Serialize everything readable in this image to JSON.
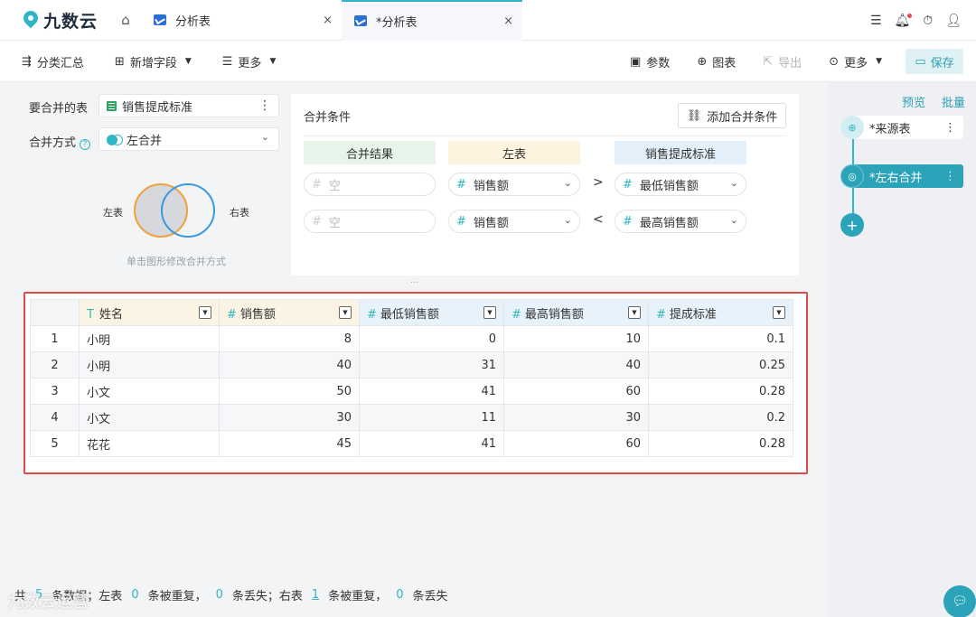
{
  "app": {
    "logo_text": "九数云"
  },
  "tabs": [
    {
      "label": "分析表",
      "close": "×"
    },
    {
      "label": "*分析表",
      "close": "×"
    }
  ],
  "top_icons": [
    "list-icon",
    "bell-icon",
    "timer-icon",
    "user-icon"
  ],
  "toolbar": {
    "group_summary": "分类汇总",
    "add_field": "新增字段",
    "more_left": "更多",
    "params": "参数",
    "chart": "图表",
    "export": "导出",
    "more_right": "更多",
    "save": "保存"
  },
  "config": {
    "table_label": "要合并的表",
    "table_value": "销售提成标准",
    "method_label": "合并方式",
    "method_value": "左合并",
    "venn_left": "左表",
    "venn_right": "右表",
    "venn_hint": "单击图形修改合并方式"
  },
  "conditions": {
    "title": "合并条件",
    "add_button": "添加合并条件",
    "headers": {
      "result": "合并结果",
      "left": "左表",
      "right": "销售提成标准"
    },
    "rows": [
      {
        "result": "空",
        "left": "销售额",
        "op": ">",
        "right": "最低销售额"
      },
      {
        "result": "空",
        "left": "销售额",
        "op": "<",
        "right": "最高销售额"
      }
    ]
  },
  "grid": {
    "columns": [
      {
        "name": "姓名",
        "type": "text"
      },
      {
        "name": "销售额",
        "type": "number"
      },
      {
        "name": "最低销售额",
        "type": "number"
      },
      {
        "name": "最高销售额",
        "type": "number"
      },
      {
        "name": "提成标准",
        "type": "number"
      }
    ],
    "rows": [
      {
        "idx": "1",
        "cells": [
          "小明",
          "8",
          "0",
          "10",
          "0.1"
        ]
      },
      {
        "idx": "2",
        "cells": [
          "小明",
          "40",
          "31",
          "40",
          "0.25"
        ]
      },
      {
        "idx": "3",
        "cells": [
          "小文",
          "50",
          "41",
          "60",
          "0.28"
        ]
      },
      {
        "idx": "4",
        "cells": [
          "小文",
          "30",
          "11",
          "30",
          "0.2"
        ]
      },
      {
        "idx": "5",
        "cells": [
          "花花",
          "45",
          "41",
          "60",
          "0.28"
        ]
      }
    ]
  },
  "footer": {
    "total_prefix": "共",
    "total_count": "5",
    "total_suffix": "条数据；左表",
    "left_dup": "0",
    "dup_label": "条被重复，",
    "left_lost": "0",
    "lost_label_left": "条丢失；右表",
    "right_dup": "1",
    "dup_label2": "条被重复，",
    "right_lost": "0",
    "lost_label_right": "条丢失"
  },
  "watermark": "九数云运营",
  "right_panel": {
    "preview": "预览",
    "batch": "批量",
    "nodes": [
      {
        "label": "*来源表"
      },
      {
        "label": "*左右合并"
      }
    ]
  },
  "colors": {
    "accent": "#2fb5c5",
    "highlight": "#e04a4a"
  }
}
